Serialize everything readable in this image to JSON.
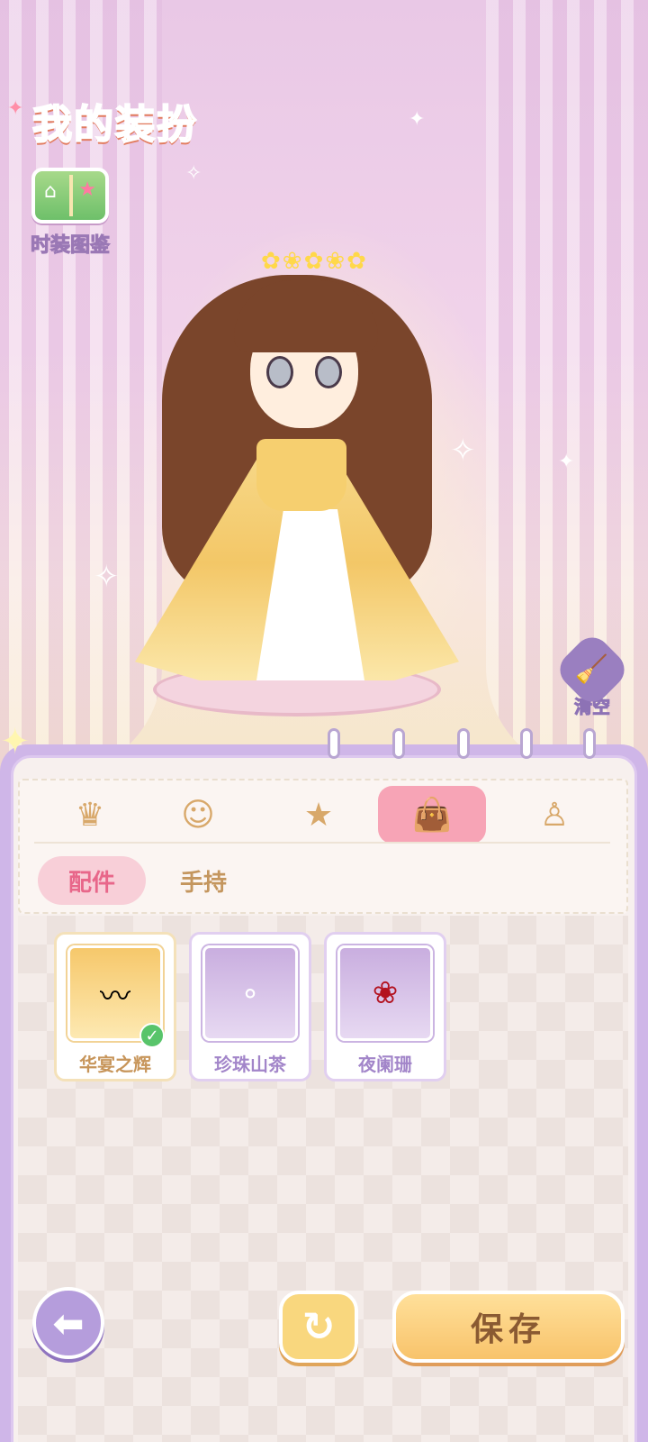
{
  "header": {
    "title": "我的装扮"
  },
  "catalog": {
    "label": "时装图鉴",
    "icon": "fashion-catalog-book-icon"
  },
  "clear": {
    "label": "清空",
    "icon": "broom-icon"
  },
  "category_tabs": [
    {
      "name": "hair",
      "icon": "hair-silhouette-icon",
      "glyph": "♛",
      "active": false
    },
    {
      "name": "face",
      "icon": "face-icon",
      "glyph": "☺",
      "active": false
    },
    {
      "name": "top",
      "icon": "tshirt-star-icon",
      "glyph": "★",
      "active": false
    },
    {
      "name": "accessory",
      "icon": "handbag-icon",
      "glyph": "👜",
      "active": true
    },
    {
      "name": "dress",
      "icon": "dress-icon",
      "glyph": "♙",
      "active": false
    }
  ],
  "subtabs": [
    {
      "label": "配件",
      "active": true
    },
    {
      "label": "手持",
      "active": false
    }
  ],
  "items": [
    {
      "label": "华宴之辉",
      "selected": true,
      "icon": "necklace-icon",
      "glyph": "〰"
    },
    {
      "label": "珍珠山茶",
      "selected": false,
      "icon": "pearl-necklace-icon",
      "glyph": "∘"
    },
    {
      "label": "夜阑珊",
      "selected": false,
      "icon": "rose-necklace-icon",
      "glyph": "❀"
    }
  ],
  "buttons": {
    "back_glyph": "⬅",
    "refresh_glyph": "↻",
    "save_label": "保存"
  },
  "colors": {
    "accent_pink": "#f7a4b6",
    "panel_purple": "#cfb6e8",
    "gold": "#f8c36b"
  }
}
